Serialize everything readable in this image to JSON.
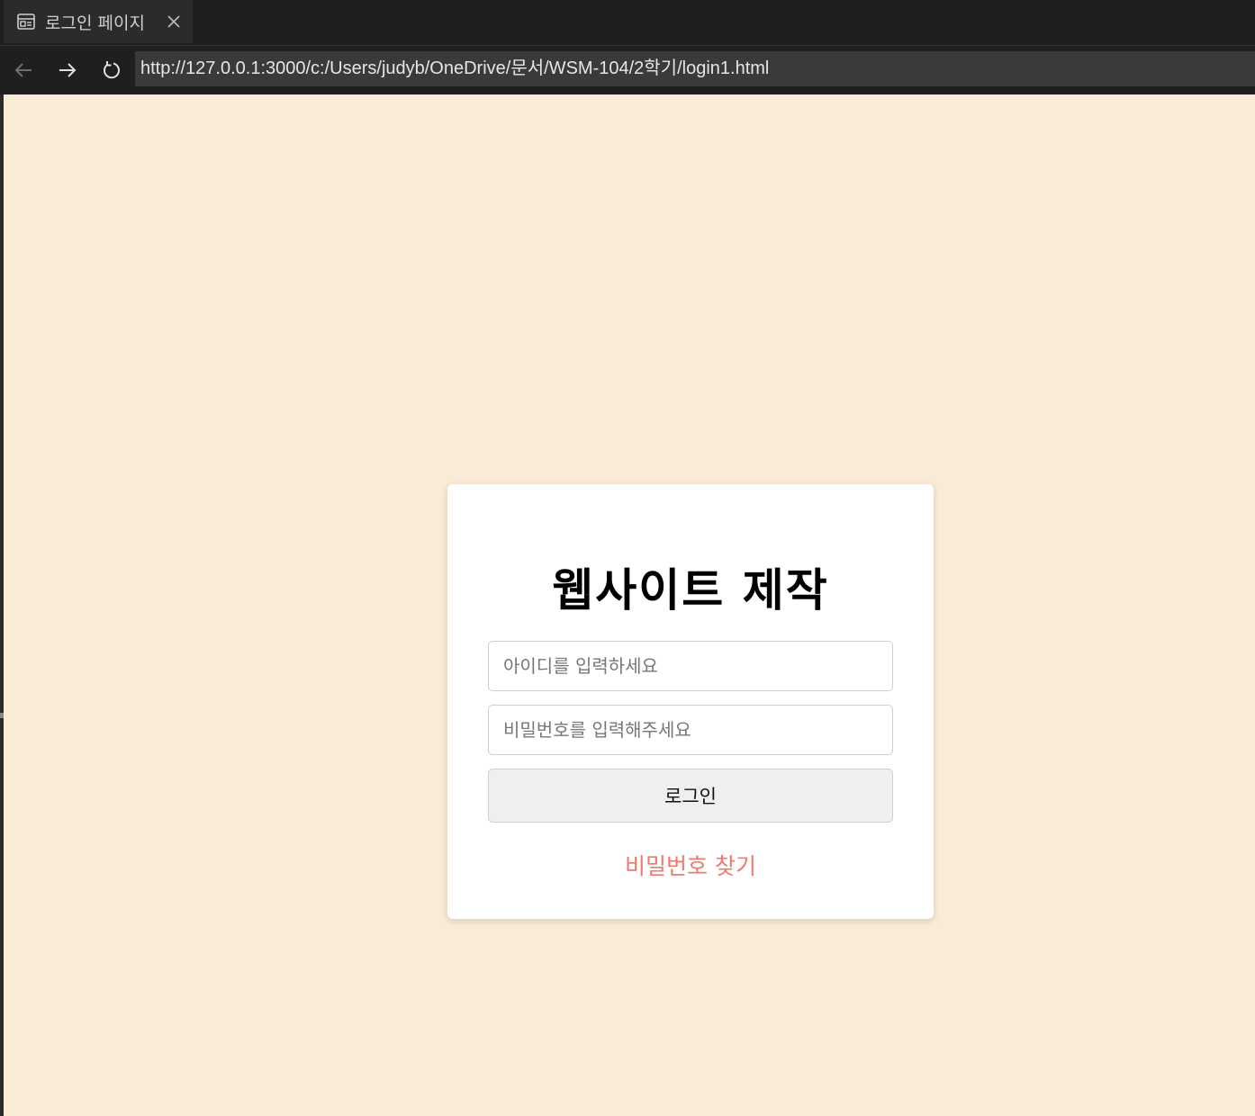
{
  "browser": {
    "tab": {
      "title": "로그인 페이지",
      "icon": "page-icon",
      "close_icon": "close-icon"
    },
    "nav": {
      "back_icon": "arrow-left-icon",
      "forward_icon": "arrow-right-icon",
      "reload_icon": "reload-icon"
    },
    "url": "http://127.0.0.1:3000/c:/Users/judyb/OneDrive/문서/WSM-104/2학기/login1.html"
  },
  "page": {
    "background_color": "#faebd7",
    "card": {
      "title": "웹사이트 제작",
      "id_field": {
        "placeholder": "아이디를 입력하세요",
        "value": ""
      },
      "password_field": {
        "placeholder": "비밀번호를 입력해주세요",
        "value": ""
      },
      "login_button": "로그인",
      "forgot_password_link": "비밀번호 찾기",
      "link_color": "#ee7a6e"
    }
  }
}
